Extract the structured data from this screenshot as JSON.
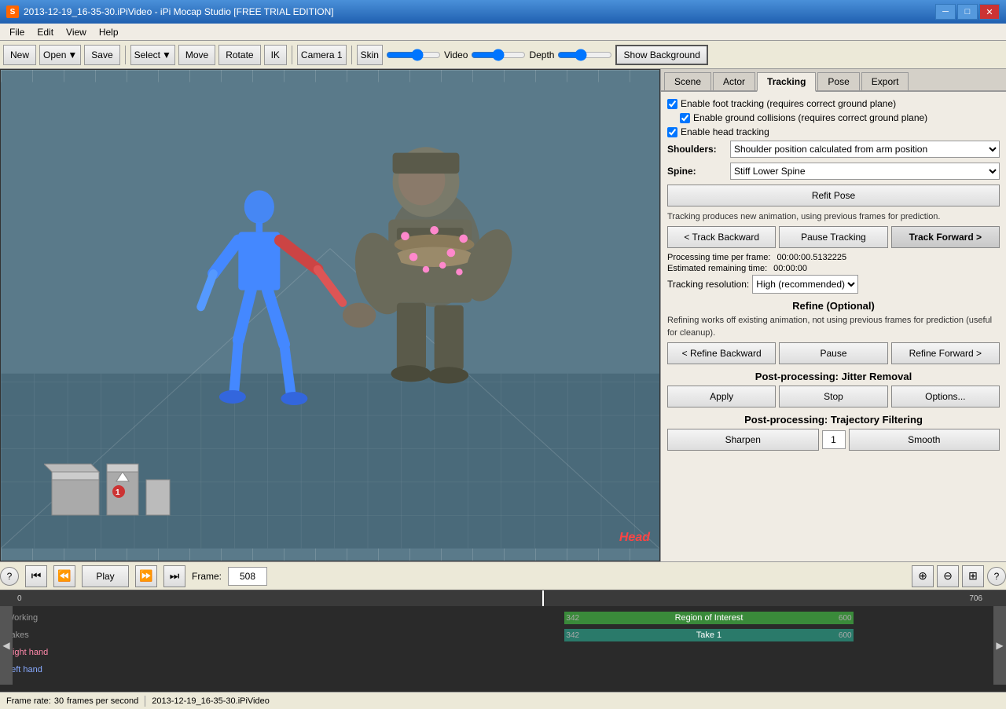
{
  "window": {
    "title": "2013-12-19_16-35-30.iPiVideo - iPi Mocap Studio [FREE TRIAL EDITION]",
    "icon": "S"
  },
  "menu": {
    "items": [
      "File",
      "Edit",
      "View",
      "Help"
    ]
  },
  "toolbar": {
    "new_label": "New",
    "open_label": "Open",
    "save_label": "Save",
    "select_label": "Select",
    "move_label": "Move",
    "rotate_label": "Rotate",
    "ik_label": "IK",
    "camera_label": "Camera 1",
    "skin_label": "Skin",
    "video_label": "Video",
    "depth_label": "Depth",
    "show_background_label": "Show Background",
    "dropdown_arrow": "▼"
  },
  "tabs": {
    "items": [
      "Scene",
      "Actor",
      "Tracking",
      "Pose",
      "Export"
    ],
    "active": "Tracking"
  },
  "tracking": {
    "enable_foot_label": "Enable foot tracking (requires correct ground plane)",
    "enable_ground_label": "Enable ground collisions (requires correct ground plane)",
    "enable_head_label": "Enable head tracking",
    "shoulders_label": "Shoulders:",
    "shoulders_value": "Shoulder position calculated from arm position",
    "spine_label": "Spine:",
    "spine_value": "Stiff Lower Spine",
    "refit_pose_label": "Refit Pose",
    "tracking_info": "Tracking produces new animation, using previous frames for prediction.",
    "track_backward_label": "< Track Backward",
    "pause_tracking_label": "Pause Tracking",
    "track_forward_label": "Track Forward >",
    "processing_time_label": "Processing time per frame:",
    "processing_time_value": "00:00:00.5132225",
    "estimated_remaining_label": "Estimated remaining time:",
    "estimated_remaining_value": "00:00:00",
    "tracking_resolution_label": "Tracking resolution:",
    "tracking_resolution_value": "High (recommended)",
    "refine_title": "Refine (Optional)",
    "refine_info": "Refining works off existing animation, not using previous frames for prediction (useful for cleanup).",
    "refine_backward_label": "< Refine Backward",
    "pause_label": "Pause",
    "refine_forward_label": "Refine Forward >",
    "postprocessing_jitter_title": "Post-processing: Jitter Removal",
    "apply_label": "Apply",
    "stop_label": "Stop",
    "options_label": "Options...",
    "postprocessing_trajectory_title": "Post-processing: Trajectory Filtering",
    "sharpen_label": "Sharpen",
    "trajectory_value": "1",
    "smooth_label": "Smooth"
  },
  "viewport": {
    "head_label": "Head"
  },
  "playback": {
    "play_label": "Play",
    "frame_label": "Frame:",
    "frame_value": "508"
  },
  "timeline": {
    "ruler_start": "0",
    "ruler_end": "706",
    "tracks": [
      {
        "label": "Working",
        "color": "green",
        "start_pct": 50,
        "width_pct": 33,
        "text": "",
        "show_markers": true,
        "marker_start": "342",
        "marker_end": "600",
        "bar_label": "Region of Interest"
      },
      {
        "label": "Takes",
        "color": "blue-green",
        "start_pct": 50,
        "width_pct": 33,
        "text": "Take 1",
        "show_markers": true,
        "marker_start": "342",
        "marker_end": "600",
        "bar_label": "Take 1"
      },
      {
        "label": "Right hand",
        "color": "none",
        "pink": true
      },
      {
        "label": "Left hand",
        "color": "none",
        "pink": false
      }
    ]
  },
  "status_bar": {
    "frame_rate_label": "Frame rate:",
    "frame_rate_value": "30",
    "fps_label": "frames per second",
    "file_name": "2013-12-19_16-35-30.iPiVideo"
  }
}
